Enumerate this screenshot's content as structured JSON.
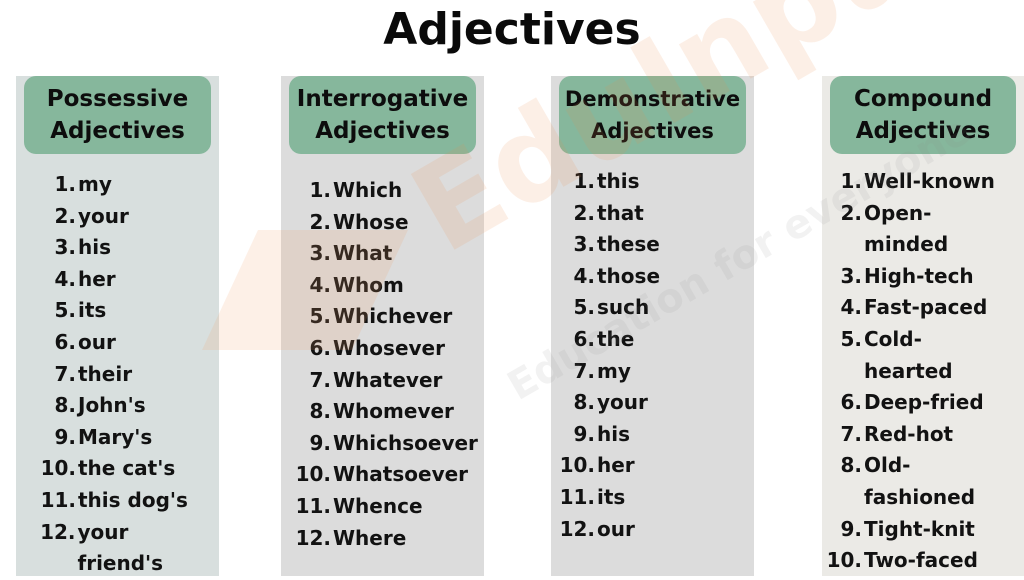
{
  "title": "Adjectives",
  "watermark": {
    "brand": "EduInput",
    "tagline": "Education for everyone"
  },
  "colors": {
    "header_green": "#86b79c",
    "possessive_bg": "#d8dfde",
    "neutral_bg": "#dcdcdc",
    "compound_bg": "#ebeae6"
  },
  "columns": [
    {
      "heading": [
        "Possessive",
        "Adjectives"
      ],
      "items": [
        {
          "n": "1.",
          "t": "my"
        },
        {
          "n": "2.",
          "t": "your"
        },
        {
          "n": "3.",
          "t": "his"
        },
        {
          "n": "4.",
          "t": "her"
        },
        {
          "n": "5.",
          "t": "its"
        },
        {
          "n": "6.",
          "t": "our"
        },
        {
          "n": "7.",
          "t": "their"
        },
        {
          "n": "8.",
          "t": "John's"
        },
        {
          "n": "9.",
          "t": "Mary's"
        },
        {
          "n": "10.",
          "t": "the cat's"
        },
        {
          "n": "11.",
          "t": "this dog's"
        },
        {
          "n": "12.",
          "t": "your friend's"
        }
      ]
    },
    {
      "heading": [
        "Interrogative",
        "Adjectives"
      ],
      "items": [
        {
          "n": "1.",
          "t": "Which"
        },
        {
          "n": "2.",
          "t": "Whose"
        },
        {
          "n": "3.",
          "t": "What"
        },
        {
          "n": "4.",
          "t": "Whom"
        },
        {
          "n": "5.",
          "t": "Whichever"
        },
        {
          "n": "6.",
          "t": "Whosever"
        },
        {
          "n": "7.",
          "t": "Whatever"
        },
        {
          "n": "8.",
          "t": "Whomever"
        },
        {
          "n": "9.",
          "t": "Whichsoever"
        },
        {
          "n": "10.",
          "t": "Whatsoever"
        },
        {
          "n": "11.",
          "t": "Whence"
        },
        {
          "n": "12.",
          "t": "Where"
        }
      ]
    },
    {
      "heading": [
        "Demonstrative",
        "Adjectives"
      ],
      "items": [
        {
          "n": "1.",
          "t": "this"
        },
        {
          "n": "2.",
          "t": "that"
        },
        {
          "n": "3.",
          "t": "these"
        },
        {
          "n": "4.",
          "t": "those"
        },
        {
          "n": "5.",
          "t": "such"
        },
        {
          "n": "6.",
          "t": "the"
        },
        {
          "n": "7.",
          "t": "my"
        },
        {
          "n": "8.",
          "t": "your"
        },
        {
          "n": "9.",
          "t": "his"
        },
        {
          "n": "10.",
          "t": "her"
        },
        {
          "n": "11.",
          "t": "its"
        },
        {
          "n": "12.",
          "t": "our"
        }
      ]
    },
    {
      "heading": [
        "Compound",
        "Adjectives"
      ],
      "items": [
        {
          "n": "1.",
          "t": "Well-known"
        },
        {
          "n": "2.",
          "t": "Open-\nminded"
        },
        {
          "n": "3.",
          "t": "High-tech"
        },
        {
          "n": "4.",
          "t": "Fast-paced"
        },
        {
          "n": "5.",
          "t": "Cold-\nhearted"
        },
        {
          "n": "6.",
          "t": "Deep-fried"
        },
        {
          "n": "7.",
          "t": "Red-hot"
        },
        {
          "n": "8.",
          "t": "Old-\nfashioned"
        },
        {
          "n": "9.",
          "t": "Tight-knit"
        },
        {
          "n": "10.",
          "t": "Two-faced"
        }
      ]
    }
  ]
}
